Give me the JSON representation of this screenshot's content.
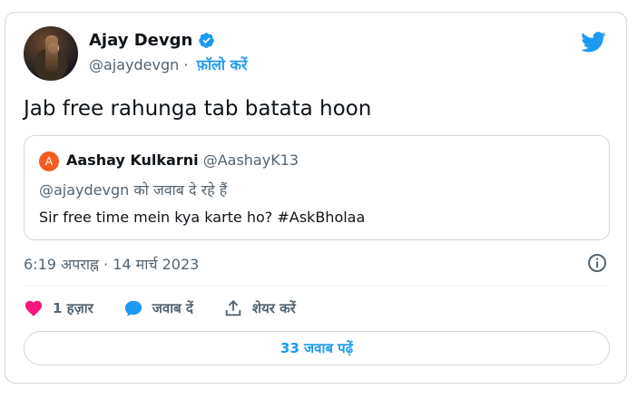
{
  "author": {
    "name": "Ajay Devgn",
    "handle": "@ajaydevgn",
    "separator": "·",
    "follow_label": "फ़ॉलो करें"
  },
  "tweet": {
    "text": "Jab free rahunga tab batata hoon",
    "timestamp": "6:19 अपराह्न · 14 मार्च 2023"
  },
  "quoted": {
    "avatar_letter": "A",
    "name": "Aashay Kulkarni",
    "handle": "@AashayK13",
    "reply_line": "@ajaydevgn को जवाब दे रहे हैं",
    "text": "Sir free time mein kya karte ho? #AskBholaa"
  },
  "actions": {
    "likes": "1 हज़ार",
    "reply": "जवाब दें",
    "share": "शेयर करें"
  },
  "read_replies": "33 जवाब पढ़ें",
  "colors": {
    "accent": "#1d9bf0",
    "like": "#f91880",
    "quote_avatar": "#f45d22"
  },
  "icons": [
    "verified-badge-icon",
    "twitter-bird-icon",
    "info-icon",
    "heart-icon",
    "reply-bubble-icon",
    "share-icon"
  ]
}
